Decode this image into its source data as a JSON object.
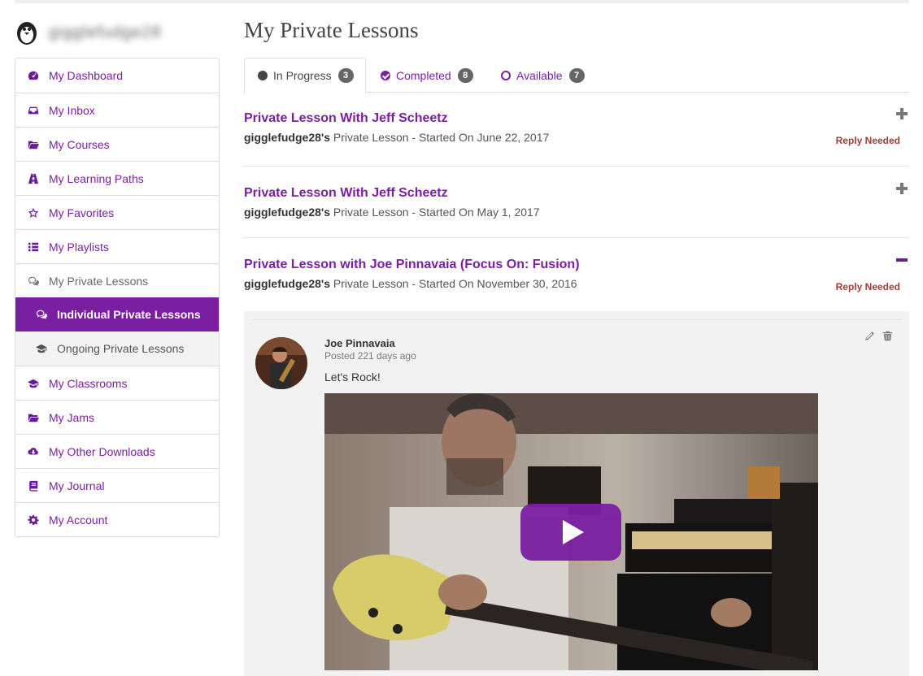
{
  "user": {
    "username": "gigglefudge28"
  },
  "sidebar": {
    "items": [
      {
        "label": "My Dashboard",
        "icon": "dashboard-icon"
      },
      {
        "label": "My Inbox",
        "icon": "inbox-icon"
      },
      {
        "label": "My Courses",
        "icon": "folder-open-icon"
      },
      {
        "label": "My Learning Paths",
        "icon": "road-icon"
      },
      {
        "label": "My Favorites",
        "icon": "star-icon"
      },
      {
        "label": "My Playlists",
        "icon": "list-icon"
      },
      {
        "label": "My Private Lessons",
        "icon": "chat-icon"
      },
      {
        "label": "Individual Private Lessons",
        "icon": "chat-icon"
      },
      {
        "label": "Ongoing Private Lessons",
        "icon": "graduation-cap-icon"
      },
      {
        "label": "My Classrooms",
        "icon": "graduation-cap-icon"
      },
      {
        "label": "My Jams",
        "icon": "folder-icon"
      },
      {
        "label": "My Other Downloads",
        "icon": "cloud-download-icon"
      },
      {
        "label": "My Journal",
        "icon": "book-icon"
      },
      {
        "label": "My Account",
        "icon": "gear-icon"
      }
    ]
  },
  "main": {
    "title": "My Private Lessons",
    "tabs": [
      {
        "label": "In Progress",
        "count": "3"
      },
      {
        "label": "Completed",
        "count": "8"
      },
      {
        "label": "Available",
        "count": "7"
      }
    ],
    "lessons": [
      {
        "title": "Private Lesson With Jeff Scheetz",
        "user": "gigglefudge28's",
        "meta": " Private Lesson - Started On June 22, 2017",
        "status": "Reply Needed"
      },
      {
        "title": "Private Lesson With Jeff Scheetz",
        "user": "gigglefudge28's",
        "meta": " Private Lesson - Started On May 1, 2017",
        "status": ""
      },
      {
        "title": "Private Lesson with Joe Pinnavaia (Focus On: Fusion)",
        "user": "gigglefudge28's",
        "meta": " Private Lesson - Started On November 30, 2016",
        "status": "Reply Needed"
      }
    ],
    "post": {
      "author": "Joe Pinnavaia",
      "time": "Posted 221 days ago",
      "text": "Let's Rock!"
    }
  },
  "colors": {
    "accent": "#7b1fa2",
    "reply_needed": "#a33b3b",
    "badge": "#666666"
  }
}
